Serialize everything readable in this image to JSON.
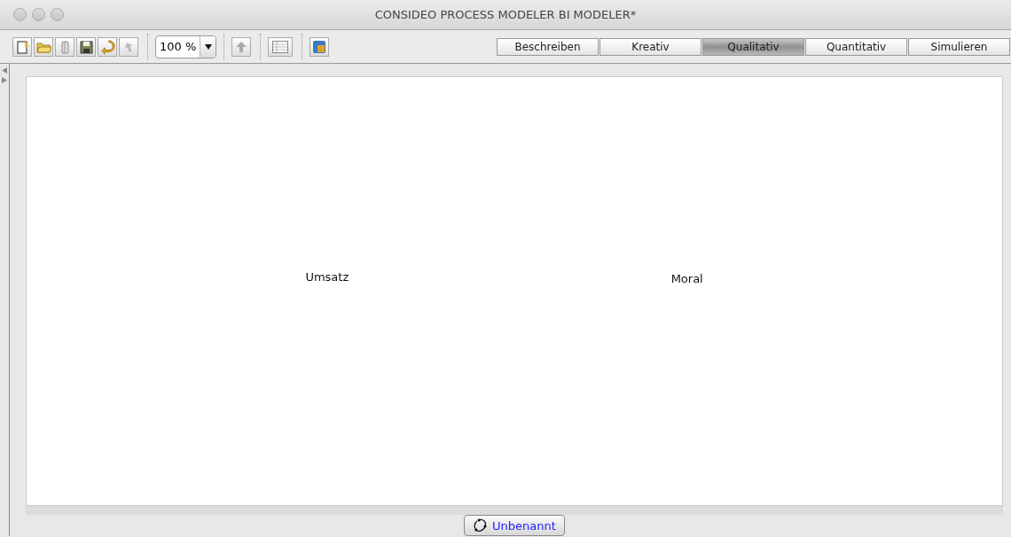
{
  "window": {
    "title": "CONSIDEO PROCESS MODELER BI MODELER*"
  },
  "toolbar": {
    "zoom": "100 %"
  },
  "modes": [
    {
      "label": "Beschreiben",
      "selected": false
    },
    {
      "label": "Kreativ",
      "selected": false
    },
    {
      "label": "Qualitativ",
      "selected": true
    },
    {
      "label": "Quantitativ",
      "selected": false
    },
    {
      "label": "Simulieren",
      "selected": false
    }
  ],
  "canvas": {
    "nodes": [
      {
        "label": "Umsatz"
      },
      {
        "label": "Moral"
      }
    ]
  },
  "model_tabs": [
    {
      "label": "Unbenannt",
      "selected": true
    }
  ]
}
